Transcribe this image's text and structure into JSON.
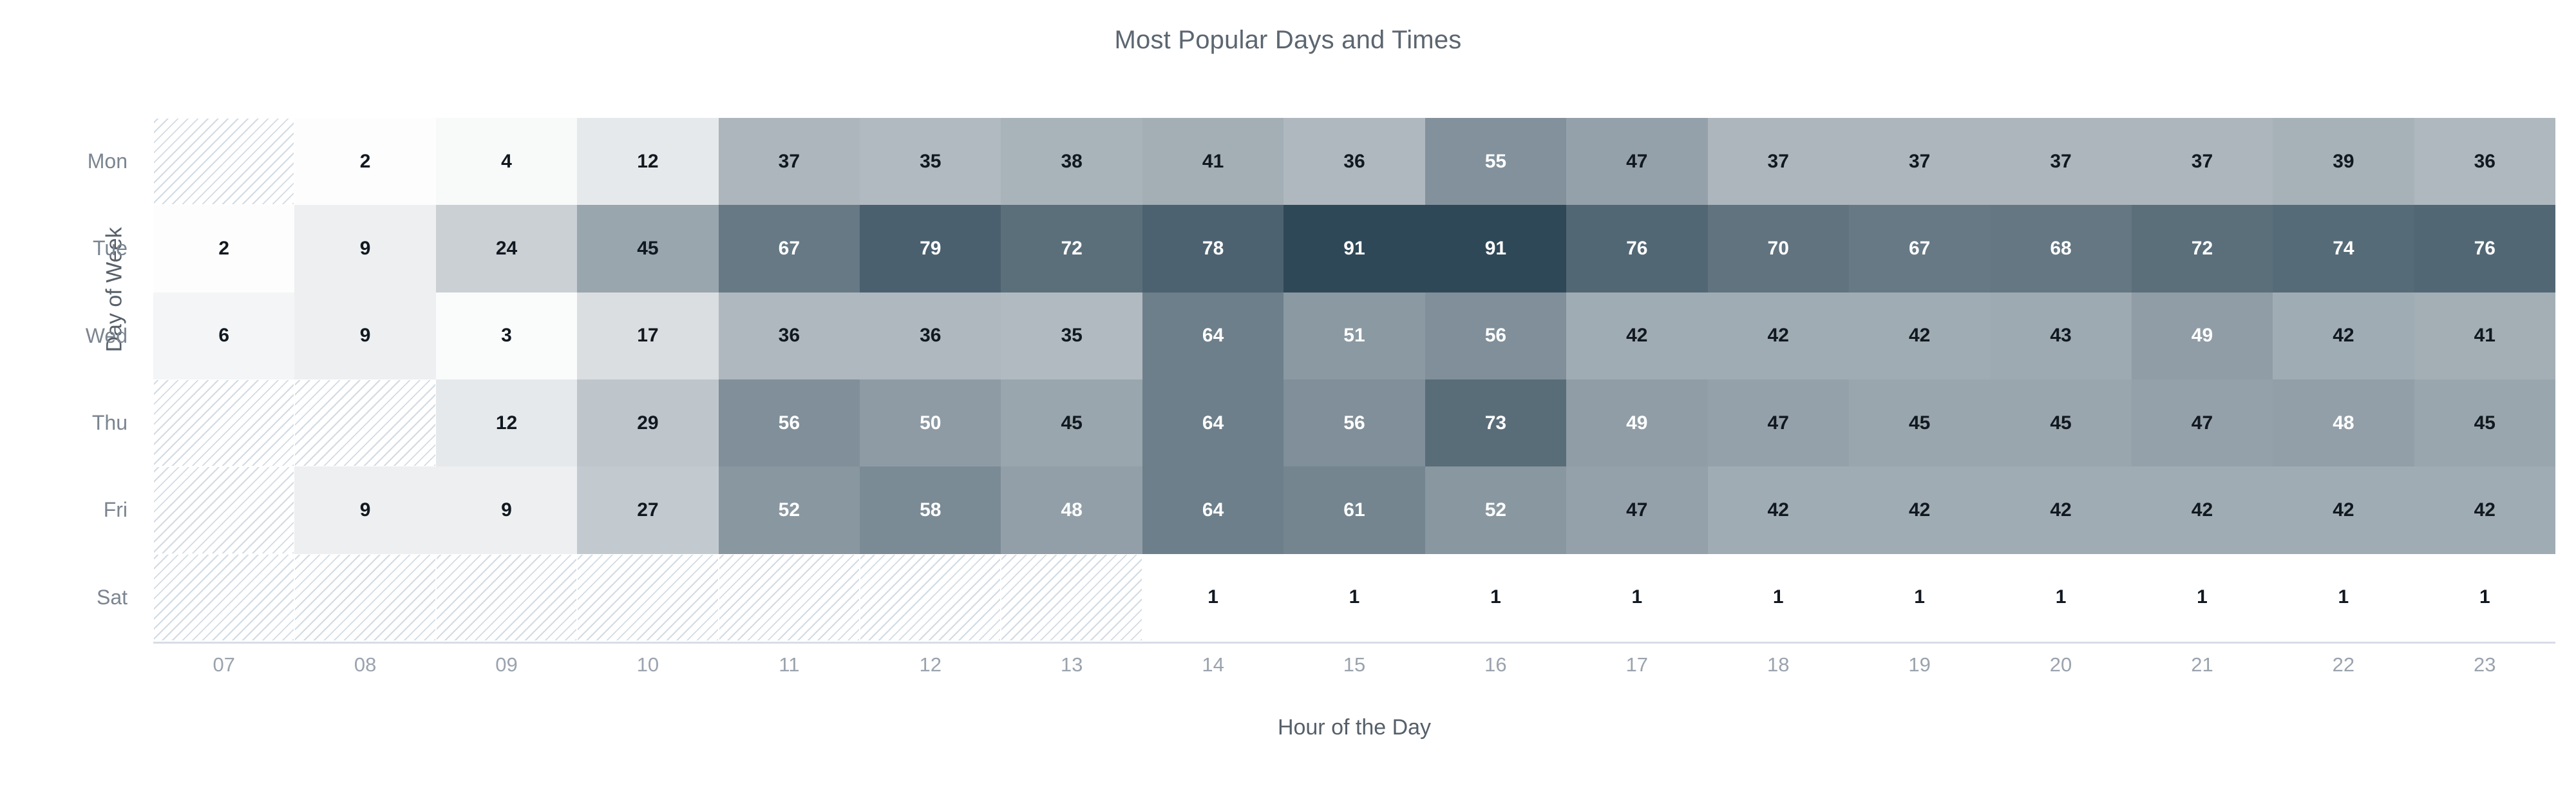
{
  "chart_data": {
    "type": "heatmap",
    "title": "Most Popular Days and Times",
    "xlabel": "Hour of the Day",
    "ylabel": "Day of Week",
    "x_tick_labels": [
      "07",
      "08",
      "09",
      "10",
      "11",
      "12",
      "13",
      "14",
      "15",
      "16",
      "17",
      "18",
      "19",
      "20",
      "21",
      "22",
      "23"
    ],
    "y_tick_labels": [
      "Mon",
      "Tue",
      "Wed",
      "Thu",
      "Fri",
      "Sat"
    ],
    "categories": [
      "07",
      "08",
      "09",
      "10",
      "11",
      "12",
      "13",
      "14",
      "15",
      "16",
      "17",
      "18",
      "19",
      "20",
      "21",
      "22",
      "23"
    ],
    "grid": false,
    "legend": "none",
    "value_range": [
      1,
      91
    ],
    "null_cell_style": "diagonal-hatch",
    "colors": {
      "min": "#ffffff",
      "max": "#2f4858",
      "hatch_line": "#adbecc",
      "text_dark": "#111820",
      "text_light": "#ffffff",
      "title_text": "#5c6670",
      "axis_label_text": "#56606a",
      "tick_text": "#9aa3ad",
      "axis_line": "#d8dce6"
    },
    "series": [
      {
        "name": "Mon",
        "values": [
          null,
          2,
          4,
          12,
          37,
          35,
          38,
          41,
          36,
          55,
          47,
          37,
          37,
          37,
          37,
          39,
          36
        ]
      },
      {
        "name": "Tue",
        "values": [
          2,
          9,
          24,
          45,
          67,
          79,
          72,
          78,
          91,
          91,
          76,
          70,
          67,
          68,
          72,
          74,
          76
        ]
      },
      {
        "name": "Wed",
        "values": [
          6,
          9,
          3,
          17,
          36,
          36,
          35,
          64,
          51,
          56,
          42,
          42,
          42,
          43,
          49,
          42,
          41
        ]
      },
      {
        "name": "Thu",
        "values": [
          null,
          null,
          12,
          29,
          56,
          50,
          45,
          64,
          56,
          73,
          49,
          47,
          45,
          45,
          47,
          48,
          45
        ]
      },
      {
        "name": "Fri",
        "values": [
          null,
          9,
          9,
          27,
          52,
          58,
          48,
          64,
          61,
          52,
          47,
          42,
          42,
          42,
          42,
          42,
          42
        ]
      },
      {
        "name": "Sat",
        "values": [
          null,
          null,
          null,
          null,
          null,
          null,
          null,
          1,
          1,
          1,
          1,
          1,
          1,
          1,
          1,
          1,
          1
        ]
      }
    ]
  }
}
